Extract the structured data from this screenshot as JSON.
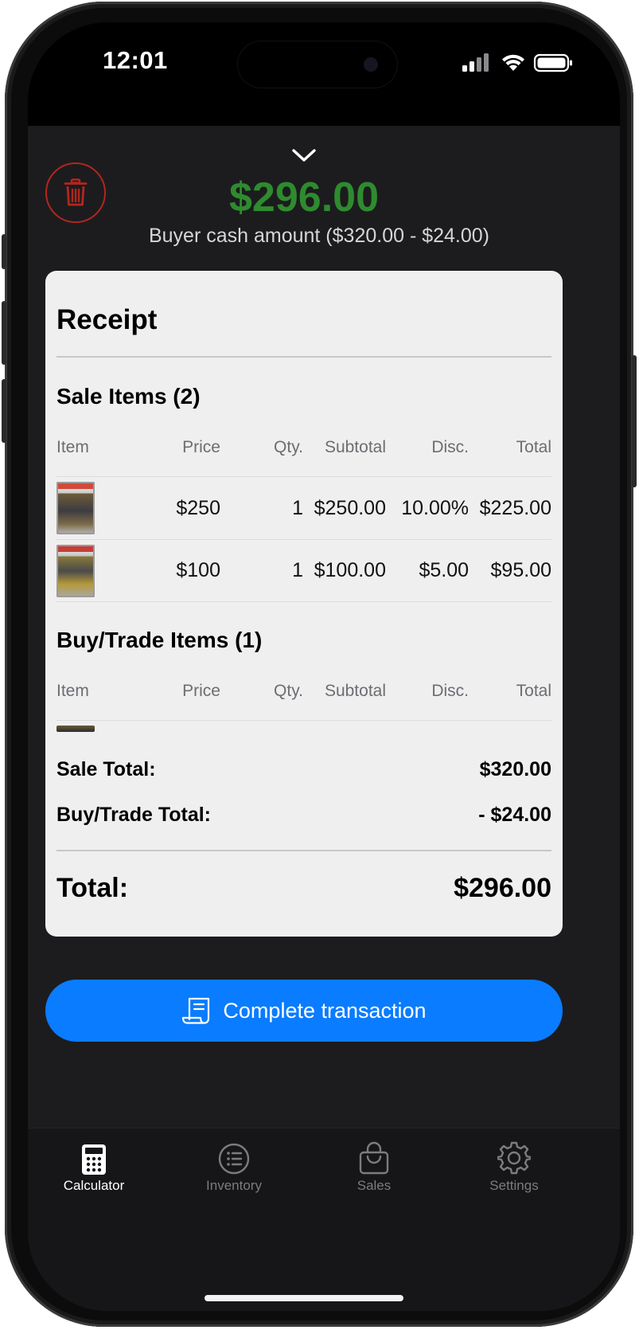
{
  "status_bar": {
    "time": "12:01"
  },
  "header": {
    "amount": "$296.00",
    "subtitle": "Buyer cash amount  ($320.00 - $24.00)",
    "amount_color": "#2e8b2e",
    "delete_color": "#b3261e"
  },
  "receipt": {
    "title": "Receipt",
    "columns": [
      "Item",
      "Price",
      "Qty.",
      "Subtotal",
      "Disc.",
      "Total"
    ],
    "sale_section_title": "Sale Items (2)",
    "sale_items": [
      {
        "price": "$250",
        "qty": "1",
        "subtotal": "$250.00",
        "disc": "10.00%",
        "total": "$225.00"
      },
      {
        "price": "$100",
        "qty": "1",
        "subtotal": "$100.00",
        "disc": "$5.00",
        "total": "$95.00"
      }
    ],
    "buy_section_title": "Buy/Trade Items (1)",
    "sale_total_label": "Sale Total:",
    "sale_total_value": "$320.00",
    "buy_total_label": "Buy/Trade Total:",
    "buy_total_value": "- $24.00",
    "total_label": "Total:",
    "total_value": "$296.00"
  },
  "cta": {
    "label": "Complete transaction",
    "color": "#0a7cff"
  },
  "tabs": [
    {
      "label": "Calculator",
      "icon": "calculator-icon",
      "active": true
    },
    {
      "label": "Inventory",
      "icon": "list-icon",
      "active": false
    },
    {
      "label": "Sales",
      "icon": "shopping-bag-icon",
      "active": false
    },
    {
      "label": "Settings",
      "icon": "gear-icon",
      "active": false
    }
  ]
}
